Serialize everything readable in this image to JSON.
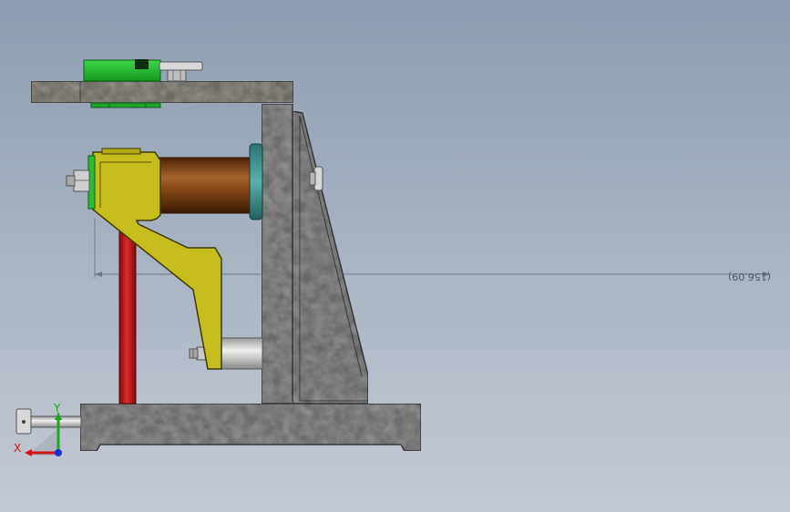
{
  "viewport": {
    "background_top": "#8d9db1",
    "background_bottom": "#c4cad3"
  },
  "dimension": {
    "text": "(156.09)",
    "mirrored": true
  },
  "triad": {
    "x_label": "X",
    "y_label": "Y",
    "x_color": "#d21414",
    "y_color": "#1ea81e",
    "z_color": "#1a2fd8"
  },
  "parts": {
    "stone_color": "#8a8a8a",
    "plate_color": "#8e8c84",
    "yellow_arm_color": "#c6bd1e",
    "brown_shaft_color": "#7a3e12",
    "green_part_color": "#22b52e",
    "red_rod_color": "#c81a1a",
    "teal_ring_color": "#3a8e8e"
  }
}
